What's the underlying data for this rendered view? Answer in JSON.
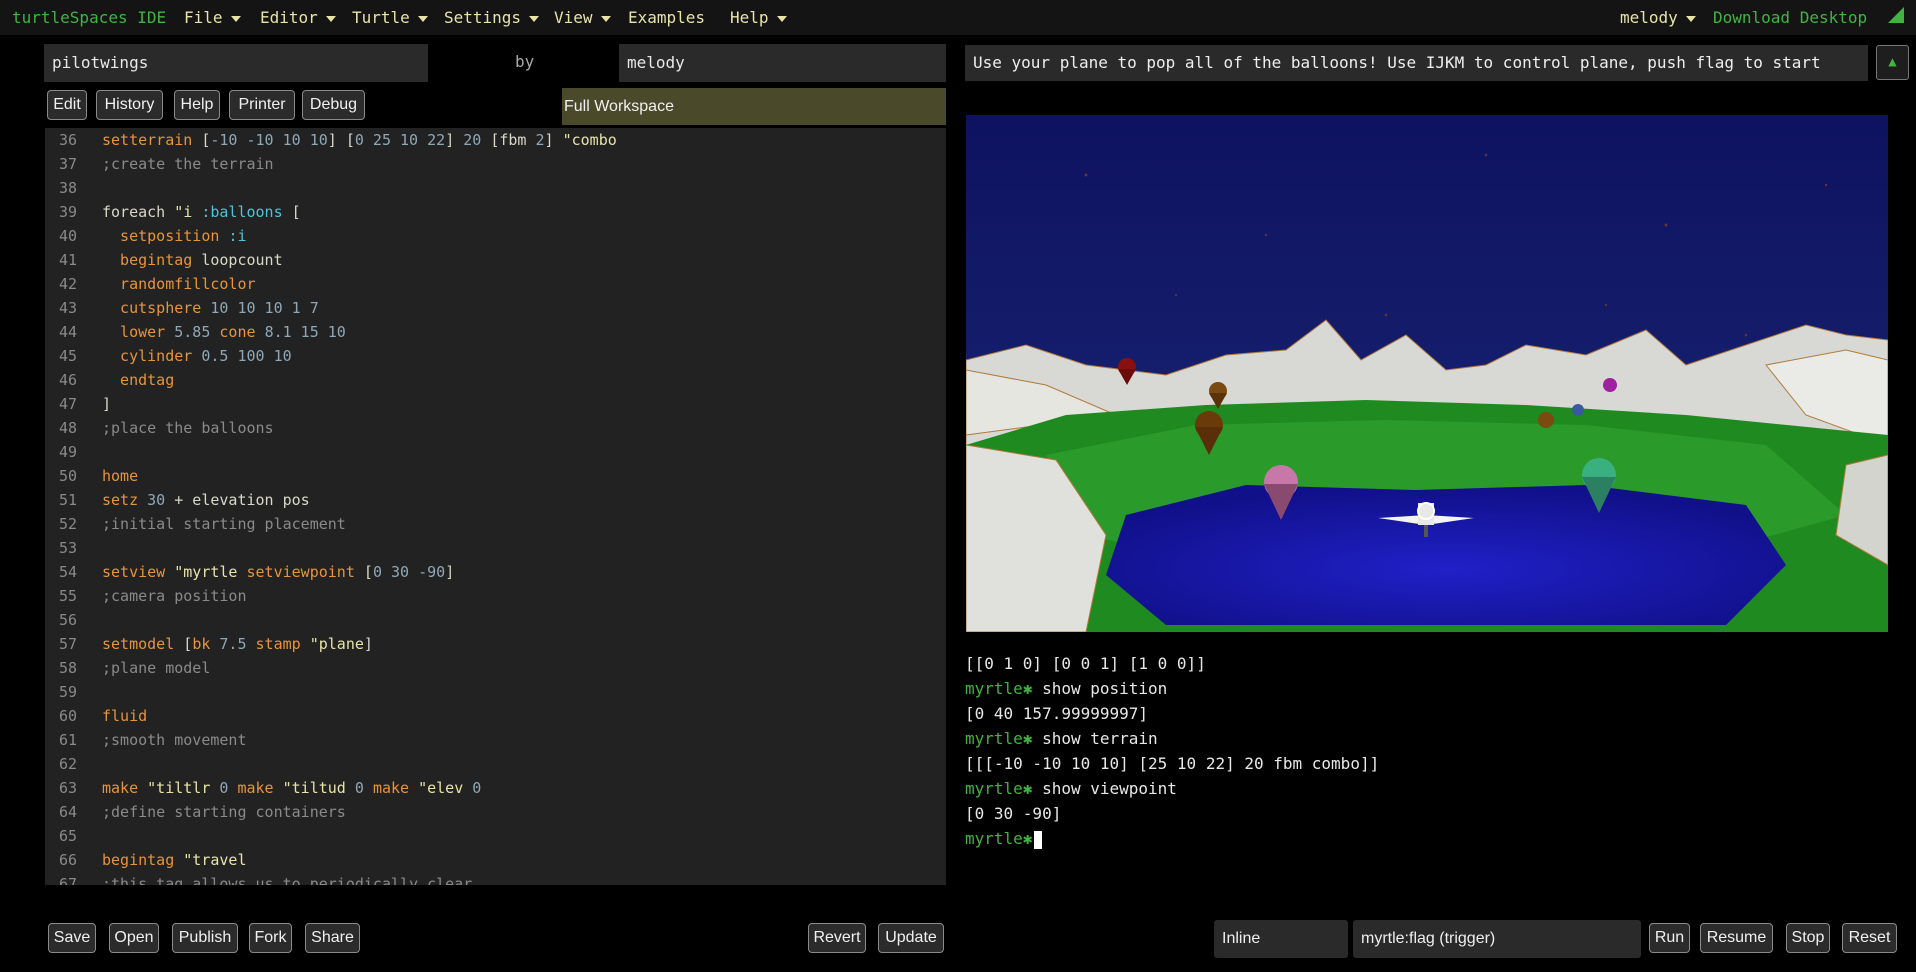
{
  "app": {
    "title": "turtleSpaces IDE"
  },
  "menu": {
    "items": [
      {
        "label": "File",
        "dropdown": true
      },
      {
        "label": "Editor",
        "dropdown": true
      },
      {
        "label": "Turtle",
        "dropdown": true
      },
      {
        "label": "Settings",
        "dropdown": true
      },
      {
        "label": "View",
        "dropdown": true
      },
      {
        "label": "Examples",
        "dropdown": false
      },
      {
        "label": "Help",
        "dropdown": true
      }
    ],
    "user": "melody",
    "download": "Download Desktop"
  },
  "project": {
    "name": "pilotwings",
    "by": "by",
    "author": "melody"
  },
  "editor_tabs": [
    "Edit",
    "History",
    "Help",
    "Printer",
    "Debug"
  ],
  "workspace_label": "Full Workspace",
  "code_lines": [
    {
      "n": "36",
      "tokens": [
        [
          "kw",
          "setterrain "
        ],
        [
          "def",
          "["
        ],
        [
          "num",
          "-10 -10 10 10"
        ],
        [
          "def",
          "] ["
        ],
        [
          "num",
          "0 25 10 22"
        ],
        [
          "def",
          "] "
        ],
        [
          "num",
          "20 "
        ],
        [
          "def",
          "[fbm "
        ],
        [
          "num",
          "2"
        ],
        [
          "def",
          "] "
        ],
        [
          "str",
          "\"combo"
        ]
      ]
    },
    {
      "n": "37",
      "tokens": [
        [
          "cmt",
          ";create the terrain"
        ]
      ]
    },
    {
      "n": "38",
      "tokens": []
    },
    {
      "n": "39",
      "tokens": [
        [
          "def",
          "foreach "
        ],
        [
          "str",
          "\"i "
        ],
        [
          "var",
          ":balloons "
        ],
        [
          "def",
          "["
        ]
      ]
    },
    {
      "n": "40",
      "tokens": [
        [
          "kw",
          "  setposition "
        ],
        [
          "var",
          ":i"
        ]
      ]
    },
    {
      "n": "41",
      "tokens": [
        [
          "kw",
          "  begintag "
        ],
        [
          "def",
          "loopcount"
        ]
      ]
    },
    {
      "n": "42",
      "tokens": [
        [
          "kw",
          "  randomfillcolor"
        ]
      ]
    },
    {
      "n": "43",
      "tokens": [
        [
          "kw",
          "  cutsphere "
        ],
        [
          "num",
          "10 10 10 1 7"
        ]
      ]
    },
    {
      "n": "44",
      "tokens": [
        [
          "kw",
          "  lower "
        ],
        [
          "num",
          "5.85 "
        ],
        [
          "kw",
          "cone "
        ],
        [
          "num",
          "8.1 15 10"
        ]
      ]
    },
    {
      "n": "45",
      "tokens": [
        [
          "kw",
          "  cylinder "
        ],
        [
          "num",
          "0.5 100 10"
        ]
      ]
    },
    {
      "n": "46",
      "tokens": [
        [
          "kw",
          "  endtag"
        ]
      ]
    },
    {
      "n": "47",
      "tokens": [
        [
          "def",
          "]"
        ]
      ]
    },
    {
      "n": "48",
      "tokens": [
        [
          "cmt",
          ";place the balloons"
        ]
      ]
    },
    {
      "n": "49",
      "tokens": []
    },
    {
      "n": "50",
      "tokens": [
        [
          "kw",
          "home"
        ]
      ]
    },
    {
      "n": "51",
      "tokens": [
        [
          "kw",
          "setz "
        ],
        [
          "num",
          "30 "
        ],
        [
          "def",
          "+ elevation pos"
        ]
      ]
    },
    {
      "n": "52",
      "tokens": [
        [
          "cmt",
          ";initial starting placement"
        ]
      ]
    },
    {
      "n": "53",
      "tokens": []
    },
    {
      "n": "54",
      "tokens": [
        [
          "kw",
          "setview "
        ],
        [
          "str",
          "\"myrtle "
        ],
        [
          "kw",
          "setviewpoint "
        ],
        [
          "def",
          "["
        ],
        [
          "num",
          "0 30 -90"
        ],
        [
          "def",
          "]"
        ]
      ]
    },
    {
      "n": "55",
      "tokens": [
        [
          "cmt",
          ";camera position"
        ]
      ]
    },
    {
      "n": "56",
      "tokens": []
    },
    {
      "n": "57",
      "tokens": [
        [
          "kw",
          "setmodel "
        ],
        [
          "def",
          "["
        ],
        [
          "kw",
          "bk "
        ],
        [
          "num",
          "7.5 "
        ],
        [
          "kw",
          "stamp "
        ],
        [
          "str",
          "\"plane"
        ],
        [
          "def",
          "]"
        ]
      ]
    },
    {
      "n": "58",
      "tokens": [
        [
          "cmt",
          ";plane model"
        ]
      ]
    },
    {
      "n": "59",
      "tokens": []
    },
    {
      "n": "60",
      "tokens": [
        [
          "kw",
          "fluid"
        ]
      ]
    },
    {
      "n": "61",
      "tokens": [
        [
          "cmt",
          ";smooth movement"
        ]
      ]
    },
    {
      "n": "62",
      "tokens": []
    },
    {
      "n": "63",
      "tokens": [
        [
          "kw",
          "make "
        ],
        [
          "str",
          "\"tiltlr "
        ],
        [
          "num",
          "0 "
        ],
        [
          "kw",
          "make "
        ],
        [
          "str",
          "\"tiltud "
        ],
        [
          "num",
          "0 "
        ],
        [
          "kw",
          "make "
        ],
        [
          "str",
          "\"elev "
        ],
        [
          "num",
          "0"
        ]
      ]
    },
    {
      "n": "64",
      "tokens": [
        [
          "cmt",
          ";define starting containers"
        ]
      ]
    },
    {
      "n": "65",
      "tokens": []
    },
    {
      "n": "66",
      "tokens": [
        [
          "kw",
          "begintag "
        ],
        [
          "str",
          "\"travel"
        ]
      ]
    },
    {
      "n": "67",
      "tokens": [
        [
          "cmt",
          ";this tag allows us to periodically clear"
        ]
      ]
    }
  ],
  "editor_bottom": {
    "save": "Save",
    "open": "Open",
    "publish": "Publish",
    "fork": "Fork",
    "share": "Share",
    "revert": "Revert",
    "update": "Update"
  },
  "description": "Use your plane to pop all of the balloons! Use IJKM to control plane, push flag to start",
  "console": {
    "prompt": "myrtle",
    "lines": [
      {
        "type": "out",
        "text": "[[0 1 0] [0 0 1] [1 0 0]]"
      },
      {
        "type": "in",
        "text": " show position"
      },
      {
        "type": "out",
        "text": "[0 40 157.99999997]"
      },
      {
        "type": "in",
        "text": " show terrain"
      },
      {
        "type": "out",
        "text": "[[[-10 -10 10 10] [25 10 22] 20 fbm combo]]"
      },
      {
        "type": "in",
        "text": " show viewpoint"
      },
      {
        "type": "out",
        "text": "[0 30 -90]"
      }
    ]
  },
  "run_controls": {
    "mode": "Inline",
    "target": "myrtle:flag (trigger)",
    "run": "Run",
    "resume": "Resume",
    "stop": "Stop",
    "reset": "Reset"
  },
  "colors": {
    "brand_green": "#3fb53f",
    "menu_text": "#e8e4a8",
    "scroll_thumb": "#f0e500",
    "keyword": "#e8943a",
    "sky": "#141a60",
    "water": "#1a1ab8",
    "grass": "#1e8a1e"
  }
}
